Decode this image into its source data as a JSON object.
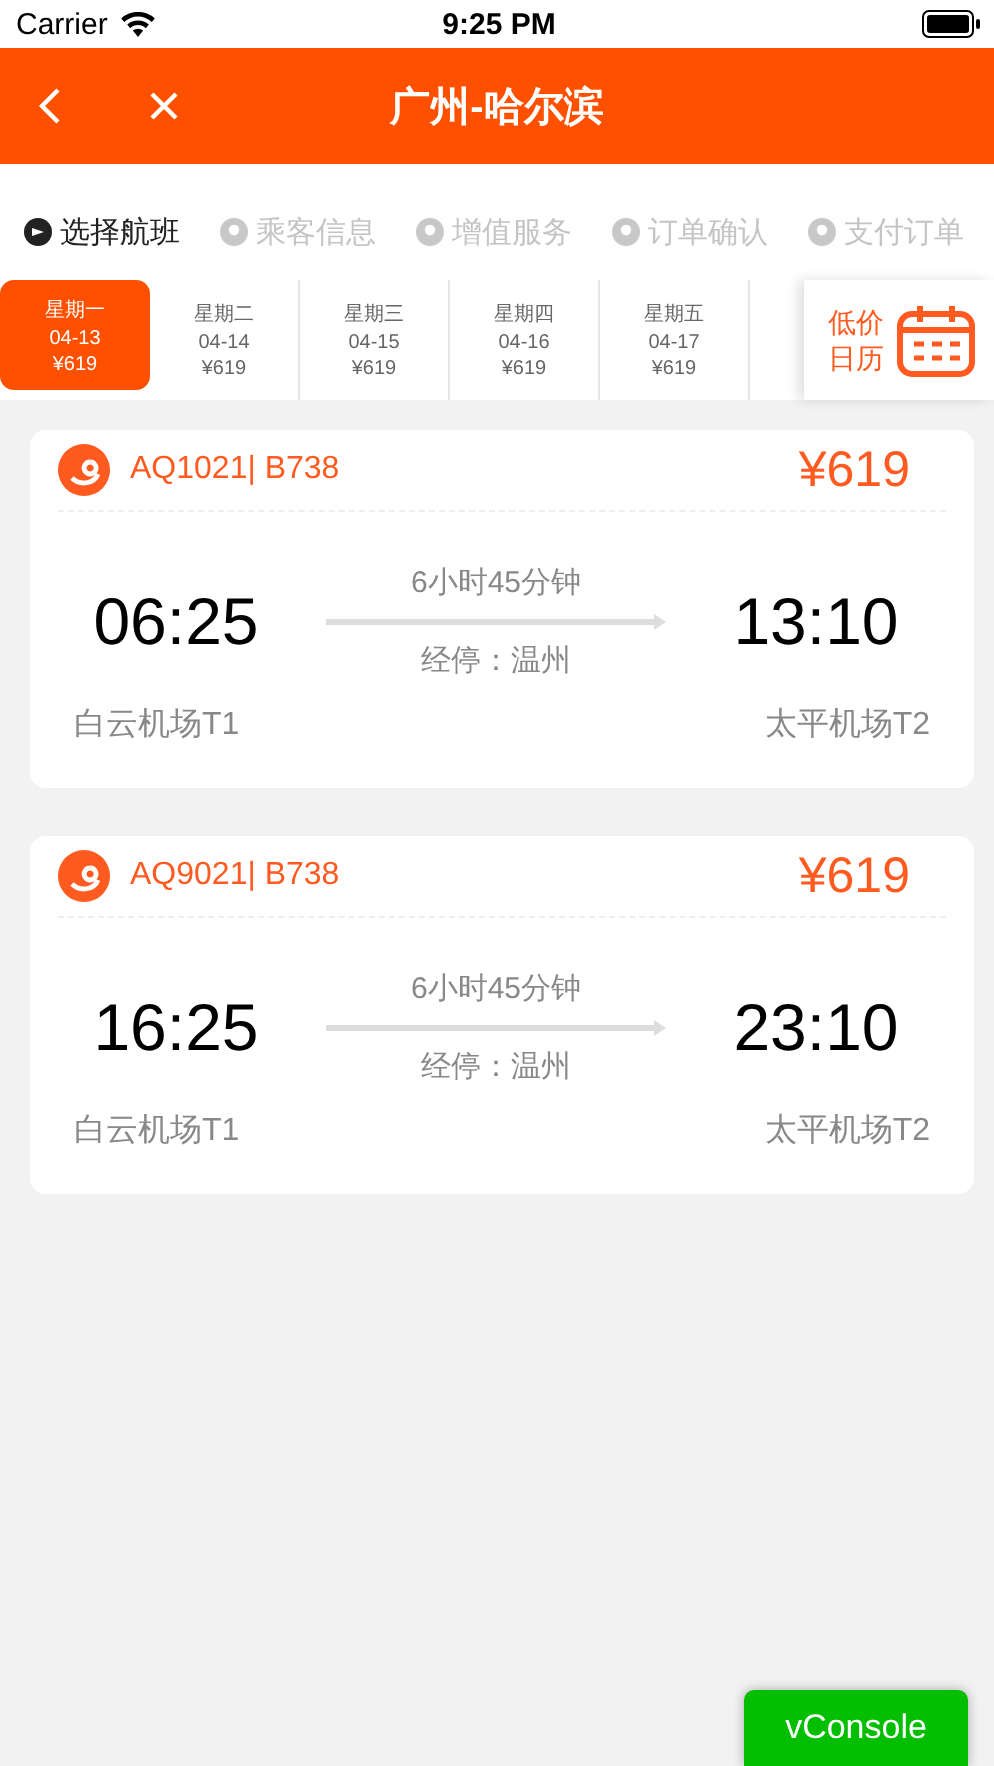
{
  "status_bar": {
    "carrier": "Carrier",
    "time": "9:25 PM"
  },
  "header": {
    "title": "广州-哈尔滨"
  },
  "steps": [
    {
      "label": "选择航班",
      "selected": true
    },
    {
      "label": "乘客信息",
      "selected": false
    },
    {
      "label": "增值服务",
      "selected": false
    },
    {
      "label": "订单确认",
      "selected": false
    },
    {
      "label": "支付订单",
      "selected": false
    }
  ],
  "dates": [
    {
      "weekday": "星期一",
      "date": "04-13",
      "price": "¥619",
      "selected": true
    },
    {
      "weekday": "星期二",
      "date": "04-14",
      "price": "¥619",
      "selected": false
    },
    {
      "weekday": "星期三",
      "date": "04-15",
      "price": "¥619",
      "selected": false
    },
    {
      "weekday": "星期四",
      "date": "04-16",
      "price": "¥619",
      "selected": false
    },
    {
      "weekday": "星期五",
      "date": "04-17",
      "price": "¥619",
      "selected": false
    }
  ],
  "calendar_button": {
    "label": "低价日历"
  },
  "flights": [
    {
      "flight": "AQ1021| B738",
      "price": "¥619",
      "depart_time": "06:25",
      "arrive_time": "13:10",
      "duration": "6小时45分钟",
      "stop": "经停：温州",
      "depart_airport": "白云机场T1",
      "arrive_airport": "太平机场T2"
    },
    {
      "flight": "AQ9021| B738",
      "price": "¥619",
      "depart_time": "16:25",
      "arrive_time": "23:10",
      "duration": "6小时45分钟",
      "stop": "经停：温州",
      "depart_airport": "白云机场T1",
      "arrive_airport": "太平机场T2"
    }
  ],
  "console_button": {
    "label": "vConsole"
  }
}
